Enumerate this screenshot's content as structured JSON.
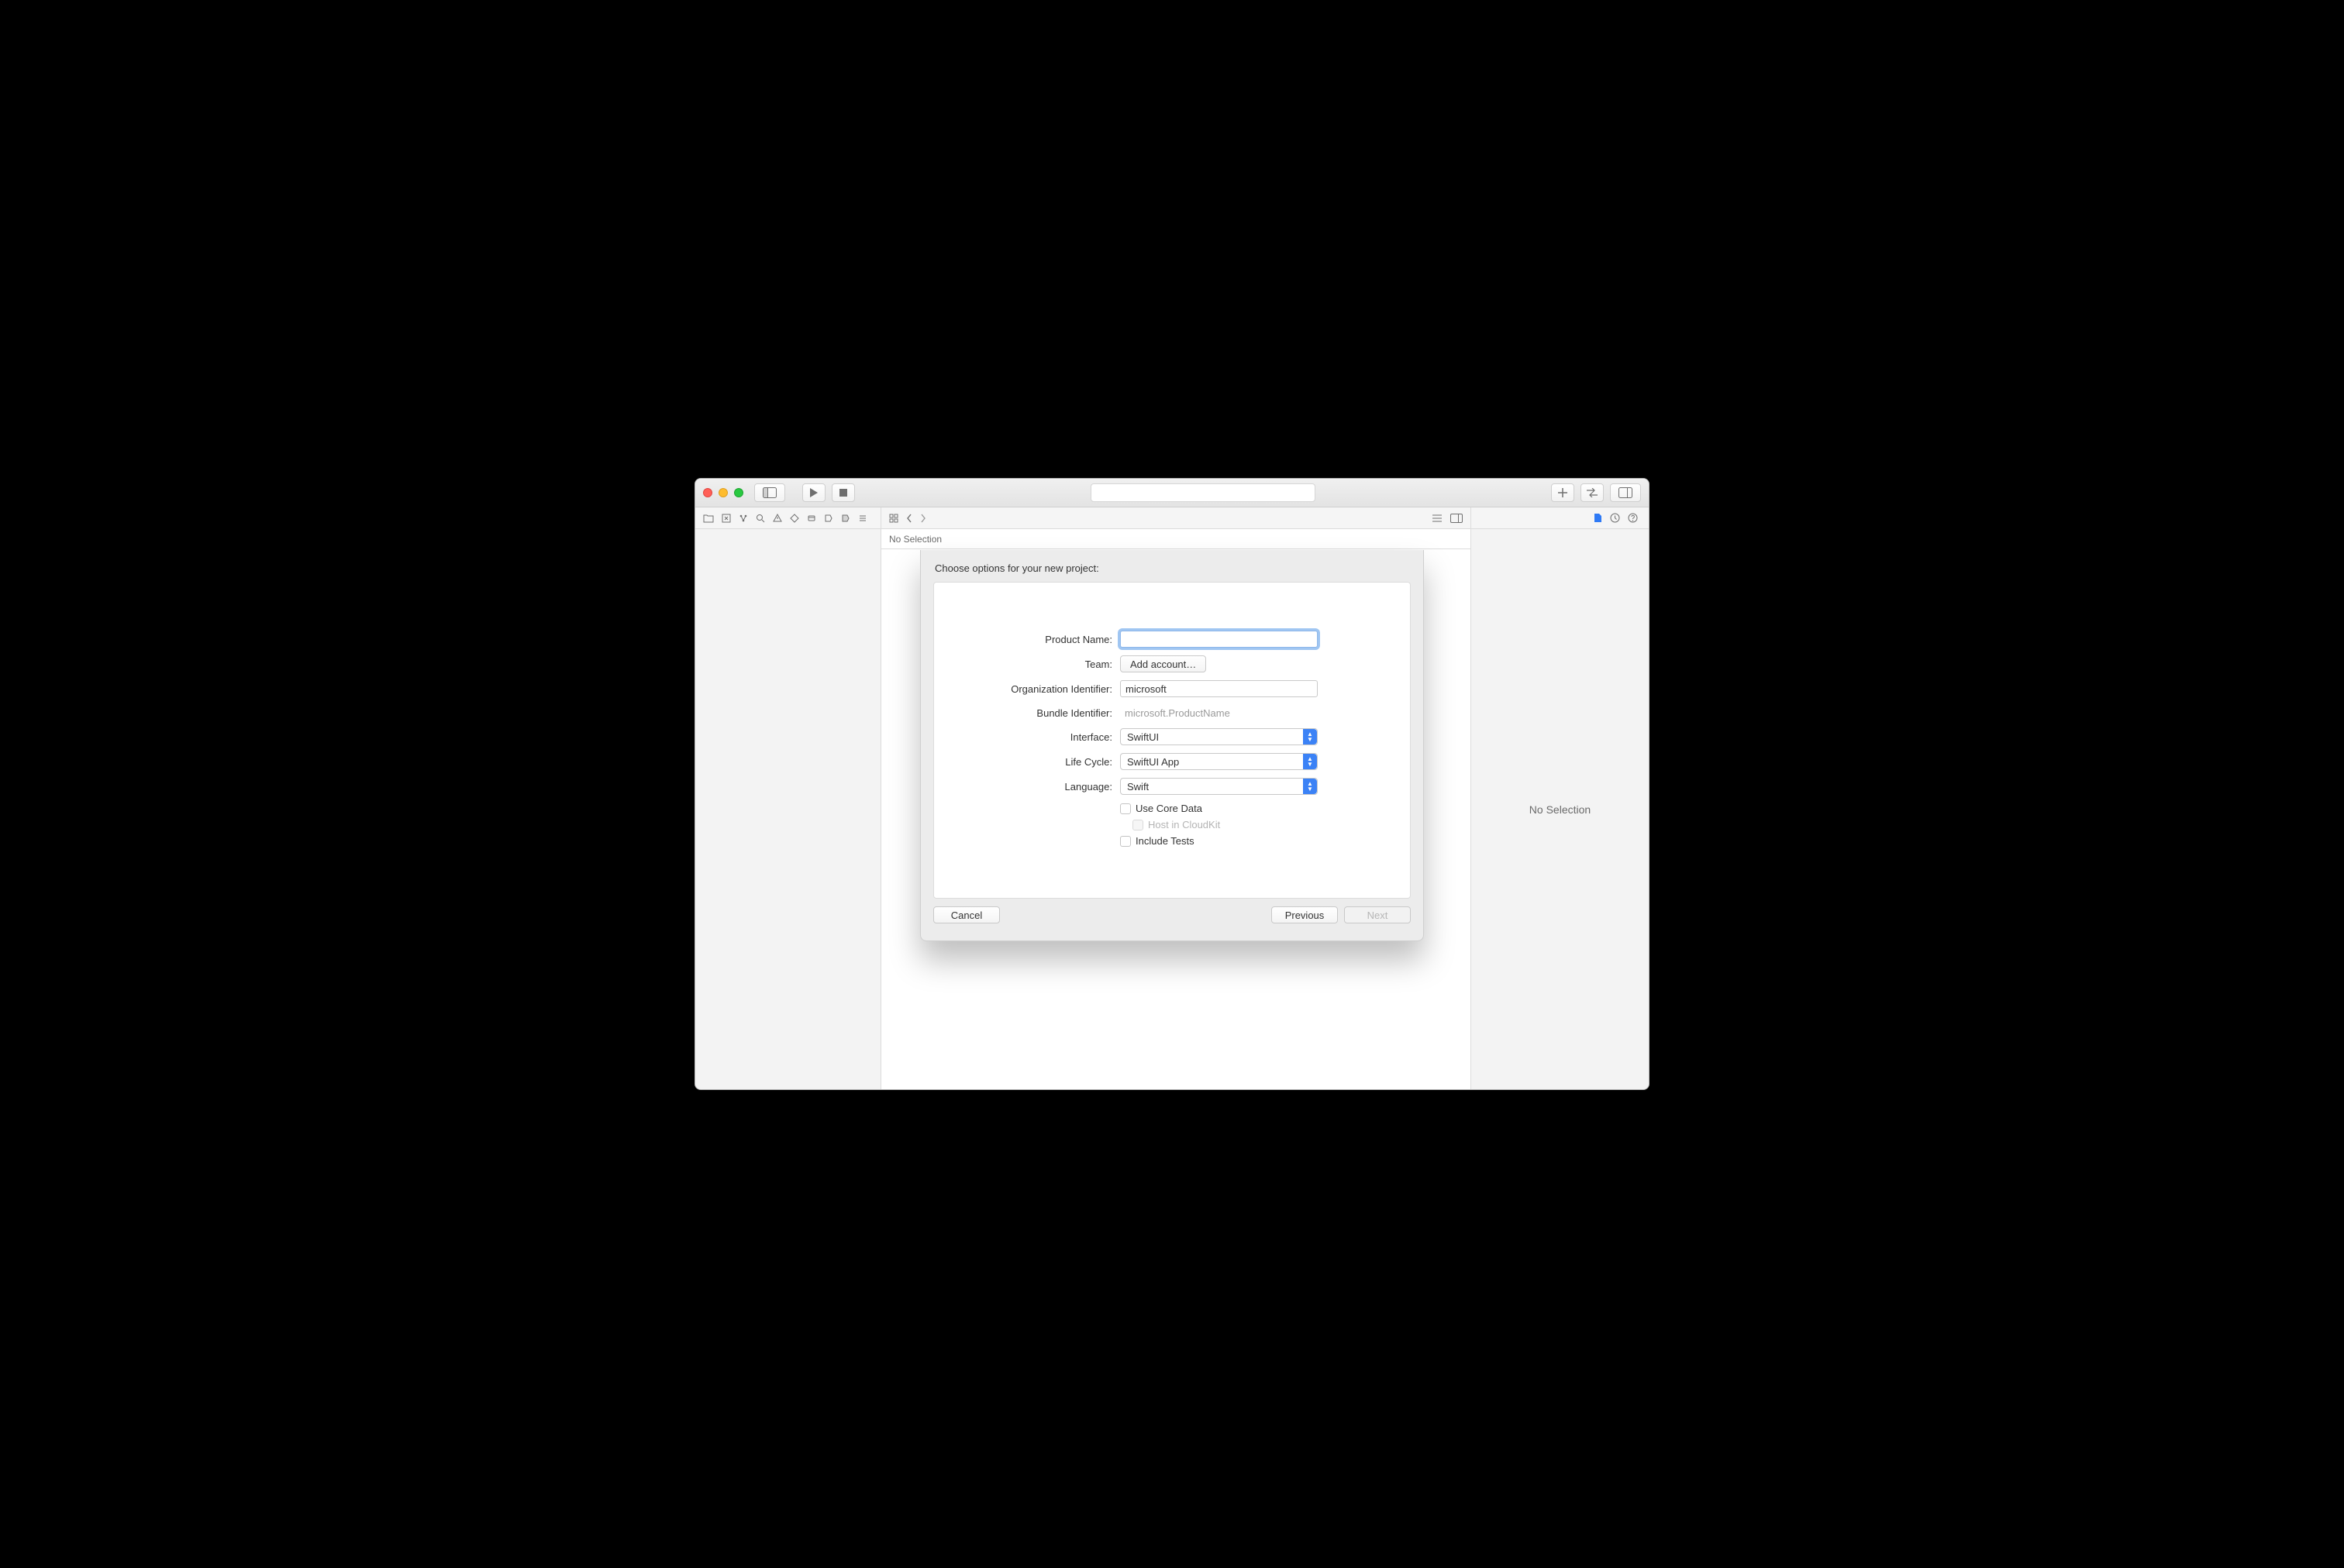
{
  "toolbar": {
    "close_icon": "close",
    "minimize_icon": "minimize",
    "zoom_icon": "zoom",
    "panel_toggle_icon": "sidebar-left",
    "run_icon": "play",
    "stop_icon": "stop",
    "library_plus_icon": "plus",
    "code_review_icon": "compare-arrows",
    "panels_icon": "sidebar-right"
  },
  "navigator_icons": [
    "folder",
    "square-x",
    "hierarchy",
    "search",
    "warning",
    "diamond",
    "message",
    "spray",
    "tag",
    "list"
  ],
  "editor_mid_icons": [
    "grid",
    "chevron-left",
    "chevron-right"
  ],
  "editor_end_icons": [
    "list-lines",
    "sidebar-right"
  ],
  "inspector_icons": [
    "doc",
    "history",
    "help"
  ],
  "docbar": {
    "text": "No Selection"
  },
  "inspector": {
    "empty_text": "No Selection"
  },
  "sheet": {
    "title": "Choose options for your new project:",
    "labels": {
      "product_name": "Product Name:",
      "team": "Team:",
      "org_id": "Organization Identifier:",
      "bundle_id": "Bundle Identifier:",
      "interface": "Interface:",
      "life_cycle": "Life Cycle:",
      "language": "Language:"
    },
    "values": {
      "product_name": "",
      "team_button": "Add account…",
      "org_id": "microsoft",
      "bundle_id": "microsoft.ProductName",
      "interface": "SwiftUI",
      "life_cycle": "SwiftUI App",
      "language": "Swift"
    },
    "checks": {
      "core_data": "Use Core Data",
      "cloudkit": "Host in CloudKit",
      "tests": "Include Tests"
    },
    "buttons": {
      "cancel": "Cancel",
      "previous": "Previous",
      "next": "Next"
    }
  }
}
